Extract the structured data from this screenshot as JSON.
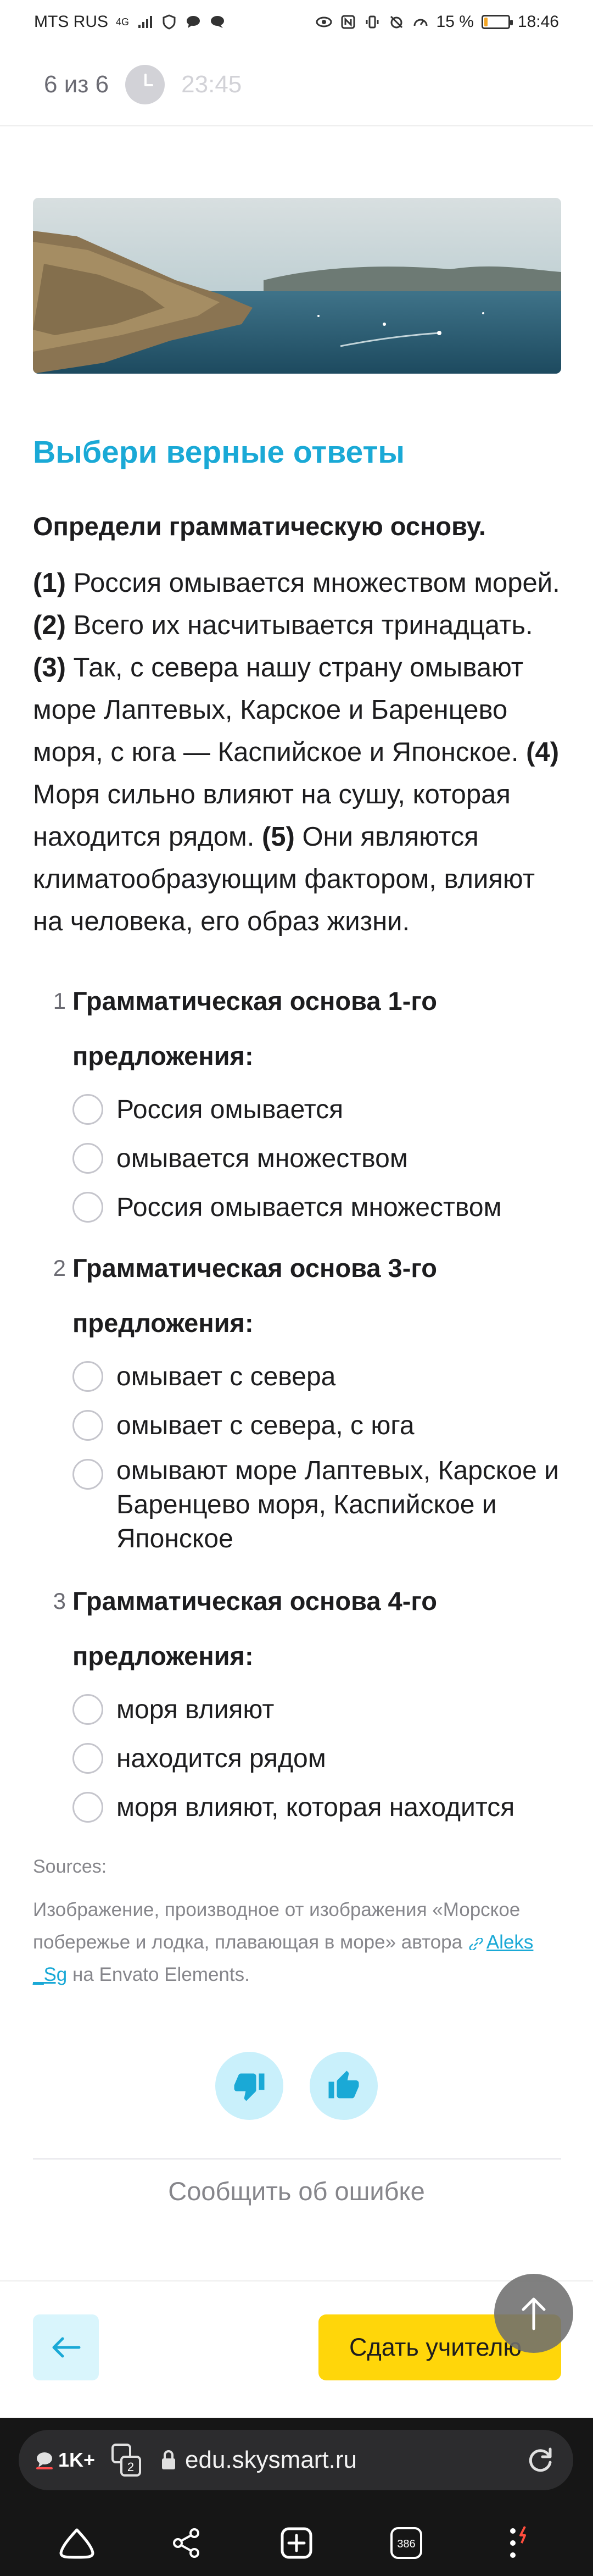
{
  "status_bar": {
    "carrier": "MTS RUS",
    "network": "4G",
    "battery_percent_text": "15 %",
    "battery_level": 0.15,
    "time": "18:46"
  },
  "header": {
    "progress": "6 из 6",
    "timer": "23:45"
  },
  "task": {
    "title": "Выбери верные ответы",
    "instruction": "Определи грамматическую основу.",
    "passage": [
      {
        "num": "(1)",
        "text": " Россия омывается множеством морей. "
      },
      {
        "num": "(2)",
        "text": " Всего их насчитывается тринадцать. "
      },
      {
        "num": "(3)",
        "text": " Так, с севера нашу страну омывают море Лаптевых, Карское и Баренцево моря, с юга — Каспийское и Японское. "
      },
      {
        "num": "(4)",
        "text": " Моря сильно влияют на сушу, которая находится рядом. "
      },
      {
        "num": "(5)",
        "text": " Они являются климатообразующим фактором, влияют на человека, его образ жизни."
      }
    ]
  },
  "questions": [
    {
      "num": "1",
      "text": "Грамматическая основа 1-го предложения:",
      "options": [
        "Россия омывается",
        "омывается множеством",
        "Россия омывается множеством"
      ]
    },
    {
      "num": "2",
      "text": "Грамматическая основа 3-го предложения:",
      "options": [
        "омывает с севера",
        "омывает с севера, с юга",
        "омывают море Лаптевых, Карское и Баренцево моря, Каспийское и Японское"
      ]
    },
    {
      "num": "3",
      "text": "Грамматическая основа 4-го предложения:",
      "options": [
        "моря влияют",
        "находится рядом",
        "моря влияют, которая находится"
      ]
    }
  ],
  "sources": {
    "label": "Sources:",
    "text_before": "Изображение, производное от изображения «Морское побережье и лодка, плавающая в море» автора ",
    "link_text": "Aleks _Sg",
    "text_after": " на Envato Elements."
  },
  "report_error": "Сообщить об ошибке",
  "bottom": {
    "submit_label": "Сдать учителю"
  },
  "browser": {
    "extensions_count": "1K+",
    "tabs_badge": "2",
    "url": "edu.skysmart.ru",
    "tab_count": "386"
  },
  "colors": {
    "accent_blue": "#1aa9d6",
    "submit_yellow": "#ffd60a",
    "feedback_bg": "#c9f0fb"
  }
}
